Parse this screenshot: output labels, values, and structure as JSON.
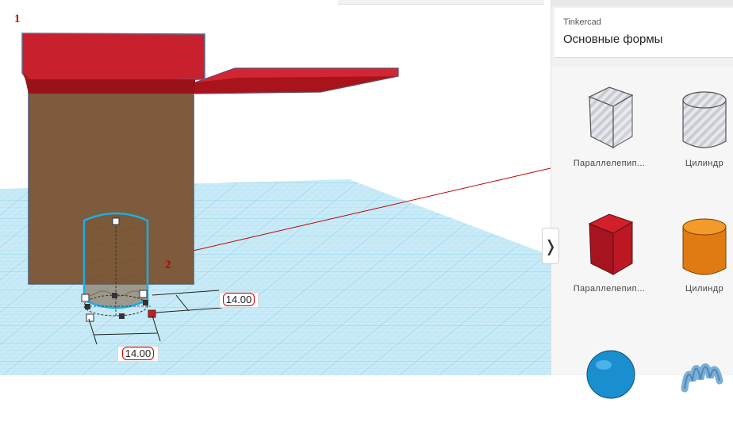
{
  "app": {
    "brand_color": "#0f7fd0",
    "workplane_color": "#b8e2f2",
    "grid_line_color": "#7cc6e4"
  },
  "viewport": {
    "annotations": [
      {
        "label": "1"
      },
      {
        "label": "2"
      }
    ],
    "dimensions": {
      "depth_value": "14.00",
      "width_value": "14.00"
    },
    "objects": {
      "roof_color": "#c8202c",
      "wall_color": "#7d5b3c",
      "cylinder_selection_color": "#1aaee8"
    }
  },
  "panel": {
    "collapse_glyph": "❭",
    "library": {
      "source": "Tinkercad",
      "name": "Основные формы"
    },
    "shapes": [
      {
        "label": "Параллелепип...",
        "icon": "box-hole-icon"
      },
      {
        "label": "Цилиндр",
        "icon": "cylinder-hole-icon"
      },
      {
        "label": "Параллелепип...",
        "icon": "box-solid-icon"
      },
      {
        "label": "Цилиндр",
        "icon": "cylinder-solid-icon"
      },
      {
        "label": "",
        "icon": "sphere-icon"
      },
      {
        "label": "",
        "icon": "scribble-icon"
      }
    ]
  }
}
